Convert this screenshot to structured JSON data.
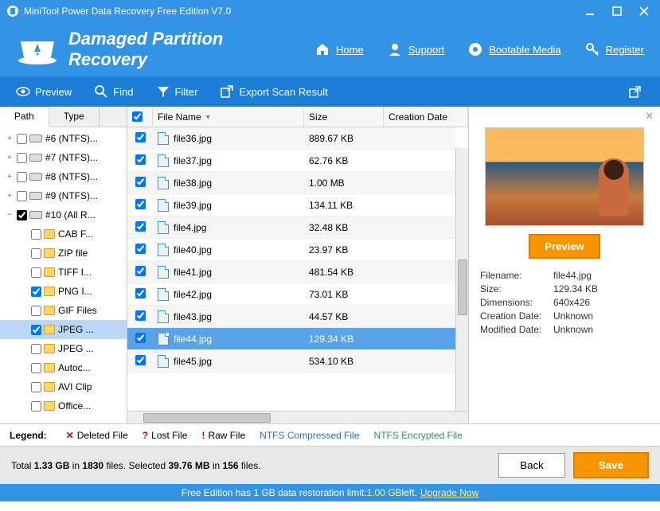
{
  "titlebar": {
    "title": "MiniTool Power Data Recovery Free Edition V7.0"
  },
  "header": {
    "title": "Damaged Partition Recovery",
    "nav": [
      {
        "label": "Home"
      },
      {
        "label": "Support"
      },
      {
        "label": "Bootable Media"
      },
      {
        "label": "Register"
      }
    ]
  },
  "toolbar": {
    "preview": "Preview",
    "find": "Find",
    "filter": "Filter",
    "export": "Export Scan Result"
  },
  "tabs": {
    "path": "Path",
    "type": "Type"
  },
  "tree": [
    {
      "indent": 0,
      "exp": "+",
      "checked": false,
      "icon": "drive",
      "label": "#6 (NTFS)..."
    },
    {
      "indent": 0,
      "exp": "+",
      "checked": false,
      "icon": "drive",
      "label": "#7 (NTFS)..."
    },
    {
      "indent": 0,
      "exp": "+",
      "checked": false,
      "icon": "drive",
      "label": "#8 (NTFS)..."
    },
    {
      "indent": 0,
      "exp": "+",
      "checked": false,
      "icon": "drive",
      "label": "#9 (NTFS)..."
    },
    {
      "indent": 0,
      "exp": "−",
      "checked": true,
      "fill": true,
      "icon": "drive",
      "label": "#10 (All R..."
    },
    {
      "indent": 1,
      "exp": "",
      "checked": false,
      "icon": "folder",
      "label": "CAB F..."
    },
    {
      "indent": 1,
      "exp": "",
      "checked": false,
      "icon": "folder",
      "label": "ZIP file"
    },
    {
      "indent": 1,
      "exp": "",
      "checked": false,
      "icon": "folder",
      "label": "TIFF I..."
    },
    {
      "indent": 1,
      "exp": "",
      "checked": true,
      "icon": "folder",
      "label": "PNG I..."
    },
    {
      "indent": 1,
      "exp": "",
      "checked": false,
      "icon": "folder",
      "label": "GIF Files"
    },
    {
      "indent": 1,
      "exp": "",
      "checked": true,
      "icon": "folder",
      "label": "JPEG ...",
      "selected": true
    },
    {
      "indent": 1,
      "exp": "",
      "checked": false,
      "icon": "folder",
      "label": "JPEG ..."
    },
    {
      "indent": 1,
      "exp": "",
      "checked": false,
      "icon": "folder",
      "label": "Autoc..."
    },
    {
      "indent": 1,
      "exp": "",
      "checked": false,
      "icon": "folder",
      "label": "AVI Clip"
    },
    {
      "indent": 1,
      "exp": "",
      "checked": false,
      "icon": "folder",
      "label": "Office..."
    }
  ],
  "grid": {
    "headers": {
      "name": "File Name",
      "size": "Size",
      "date": "Creation Date"
    },
    "rows": [
      {
        "name": "file36.jpg",
        "size": "889.67 KB"
      },
      {
        "name": "file37.jpg",
        "size": "62.76 KB"
      },
      {
        "name": "file38.jpg",
        "size": "1.00 MB"
      },
      {
        "name": "file39.jpg",
        "size": "134.11 KB"
      },
      {
        "name": "file4.jpg",
        "size": "32.48 KB"
      },
      {
        "name": "file40.jpg",
        "size": "23.97 KB"
      },
      {
        "name": "file41.jpg",
        "size": "481.54 KB"
      },
      {
        "name": "file42.jpg",
        "size": "73.01 KB"
      },
      {
        "name": "file43.jpg",
        "size": "44.57 KB"
      },
      {
        "name": "file44.jpg",
        "size": "129.34 KB",
        "selected": true
      },
      {
        "name": "file45.jpg",
        "size": "534.10 KB"
      }
    ]
  },
  "preview": {
    "button": "Preview",
    "labels": {
      "filename": "Filename:",
      "size": "Size:",
      "dimensions": "Dimensions:",
      "creation": "Creation Date:",
      "modified": "Modified Date:"
    },
    "values": {
      "filename": "file44.jpg",
      "size": "129.34 KB",
      "dimensions": "640x426",
      "creation": "Unknown",
      "modified": "Unknown"
    }
  },
  "legend": {
    "title": "Legend:",
    "deleted": "Deleted File",
    "lost": "Lost File",
    "raw": "Raw File",
    "compressed": "NTFS Compressed File",
    "encrypted": "NTFS Encrypted File"
  },
  "status": {
    "total_label_a": "Total ",
    "total_size": "1.33 GB",
    "total_label_b": " in ",
    "total_files": "1830",
    "total_label_c": " files.   Selected ",
    "sel_size": "39.76 MB",
    "sel_label_b": " in ",
    "sel_files": "156",
    "sel_label_c": " files.",
    "back": "Back",
    "save": "Save"
  },
  "footer": {
    "text_a": "Free Edition has 1 GB data restoration limit: ",
    "limit": "1.00 GB",
    "text_b": " left. ",
    "link": "Upgrade Now"
  }
}
